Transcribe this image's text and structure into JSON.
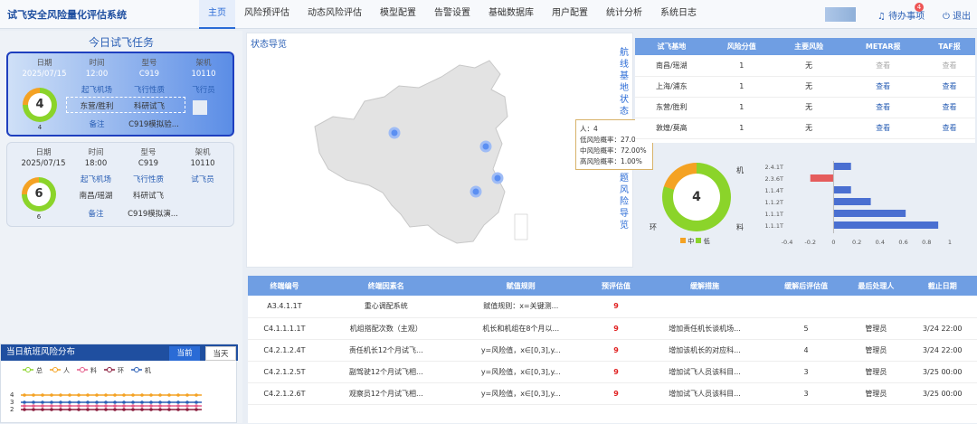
{
  "app_title": "试飞安全风险量化评估系统",
  "nav": [
    "主页",
    "风险预评估",
    "动态风险评估",
    "模型配置",
    "告警设置",
    "基础数据库",
    "用户配置",
    "统计分析",
    "系统日志"
  ],
  "todo_label": "待办事项",
  "todo_count": "4",
  "logout_label": "退出",
  "left": {
    "title": "今日试飞任务",
    "cards": [
      {
        "headers": [
          "日期",
          "时间",
          "型号",
          "架机"
        ],
        "values": [
          "2025/07/15",
          "12:00",
          "C919",
          "10110"
        ],
        "gauge": "4",
        "gauge_sub": "4",
        "row2_labels": [
          "起飞机场",
          "飞行性质",
          "飞行员"
        ],
        "row2_values": [
          "东营/胜利",
          "科研试飞",
          ""
        ],
        "remark_label": "备注",
        "remark_value": "C919模拟验..."
      },
      {
        "headers": [
          "日期",
          "时间",
          "型号",
          "架机"
        ],
        "values": [
          "2025/07/15",
          "18:00",
          "C919",
          "10110"
        ],
        "gauge": "6",
        "gauge_sub": "6",
        "row2_labels": [
          "起飞机场",
          "飞行性质",
          "试飞员"
        ],
        "row2_values": [
          "南昌/瑶湖",
          "科研试飞",
          ""
        ],
        "remark_label": "备注",
        "remark_value": "C919模拟演..."
      }
    ]
  },
  "risk_dist": {
    "title": "当日航班风险分布",
    "btn_now": "当前",
    "btn_day": "当天",
    "legend": [
      "总",
      "人",
      "料",
      "环",
      "机"
    ],
    "yticks": [
      "4",
      "3",
      "2"
    ]
  },
  "map": {
    "title": "状态导览",
    "vertical_title": "航线基地状态",
    "vertical_title2": "问题风险导览",
    "tooltip": [
      "人：4",
      "低风险概率：27.00%",
      "中风险概率：72.00%",
      "高风险概率：1.00%"
    ]
  },
  "base_table": {
    "headers": [
      "试飞基地",
      "风险分值",
      "主要风险",
      "METAR报",
      "TAF报"
    ],
    "rows": [
      [
        "南昌/瑶湖",
        "1",
        "无",
        "查看",
        "查看"
      ],
      [
        "上海/浦东",
        "1",
        "无",
        "查看",
        "查看"
      ],
      [
        "东营/胜利",
        "1",
        "无",
        "查看",
        "查看"
      ],
      [
        "敦煌/莫高",
        "1",
        "无",
        "查看",
        "查看"
      ]
    ]
  },
  "donut": {
    "value": "4",
    "labels": [
      "机",
      "料",
      "环"
    ],
    "legend": [
      "中",
      "低"
    ]
  },
  "bar_chart": {
    "categories": [
      "2.4.1T",
      "2.3.6T",
      "1.1.4T",
      "1.1.2T",
      "1.1.1T",
      "1.1.1T"
    ],
    "values": [
      0.15,
      -0.2,
      0.15,
      0.32,
      0.62,
      0.9
    ],
    "xticks": [
      "-0.4",
      "-0.2",
      "0",
      "0.2",
      "0.4",
      "0.6",
      "0.8",
      "1"
    ]
  },
  "issue_table": {
    "headers": [
      "终端编号",
      "终端因素名",
      "赋值规则",
      "预评估值",
      "缓解措施",
      "缓解后评估值",
      "最后处理人",
      "截止日期"
    ],
    "rows": [
      [
        "A3.4.1.1T",
        "重心调配系统",
        "赋值规则：x=关键测...",
        "9",
        "",
        "",
        "",
        ""
      ],
      [
        "C4.1.1.1.1T",
        "机组搭配次数（主观）",
        "机长和机组在8个月以...",
        "9",
        "增加责任机长谈机场...",
        "5",
        "管理员",
        "3/24 22:00"
      ],
      [
        "C4.2.1.2.4T",
        "责任机长12个月试飞...",
        "y=风险值，x∈[0,3],y...",
        "9",
        "增加该机长的对应科...",
        "4",
        "管理员",
        "3/24 22:00"
      ],
      [
        "C4.2.1.2.5T",
        "副驾驶12个月试飞相...",
        "y=风险值，x∈[0,3],y...",
        "9",
        "增加试飞人员该科目...",
        "3",
        "管理员",
        "3/25 00:00"
      ],
      [
        "C4.2.1.2.6T",
        "观察员12个月试飞相...",
        "y=风险值，x∈[0,3],y...",
        "9",
        "增加试飞人员该科目...",
        "3",
        "管理员",
        "3/25 00:00"
      ]
    ]
  }
}
